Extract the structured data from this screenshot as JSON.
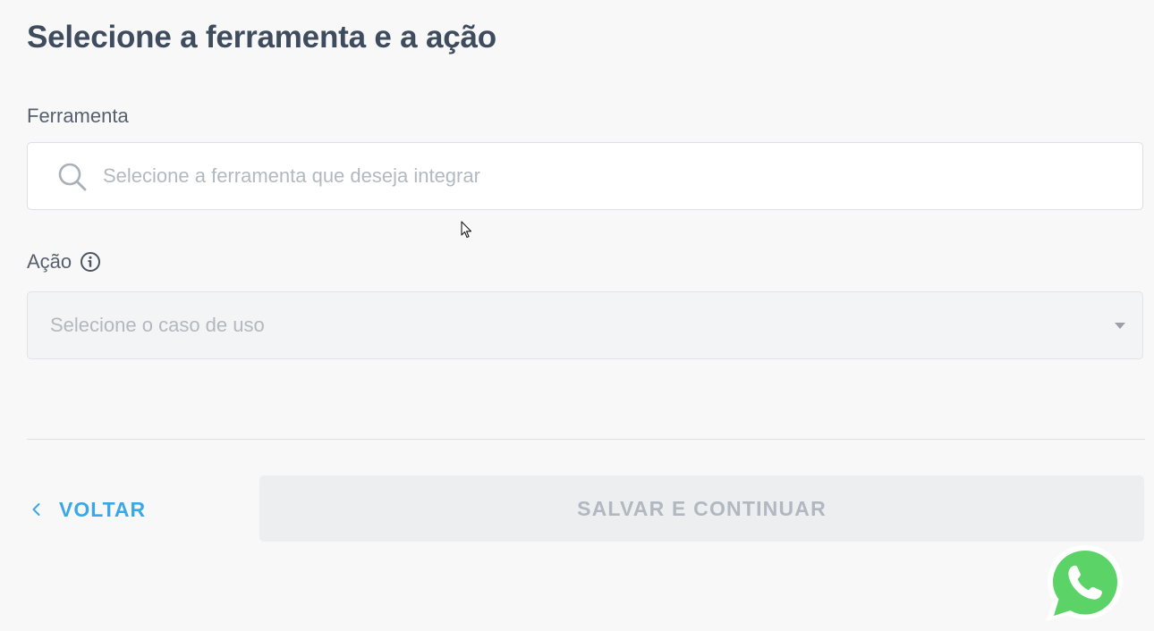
{
  "header": {
    "title": "Selecione a ferramenta e a ação"
  },
  "tool_field": {
    "label": "Ferramenta",
    "placeholder": "Selecione a ferramenta que deseja integrar",
    "value": ""
  },
  "action_field": {
    "label": "Ação",
    "placeholder": "Selecione o caso de uso"
  },
  "footer": {
    "back_label": "VOLTAR",
    "save_label": "SALVAR E CONTINUAR"
  },
  "icons": {
    "search": "search-icon",
    "info": "info-icon",
    "caret": "caret-down-icon",
    "back": "chevron-left-icon",
    "whatsapp": "whatsapp-icon"
  },
  "colors": {
    "accent": "#3aa8e8",
    "title": "#3e4c5e",
    "whatsapp": "#5bd367"
  }
}
